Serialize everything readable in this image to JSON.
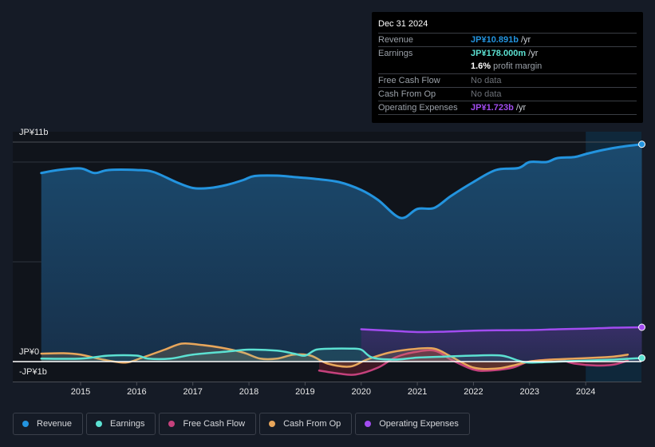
{
  "tooltip": {
    "date": "Dec 31 2024",
    "rows": [
      {
        "label": "Revenue",
        "value": "JP¥10.891b",
        "suffix": " /yr",
        "color": "#2394df"
      },
      {
        "label": "Earnings",
        "value": "JP¥178.000m",
        "suffix": " /yr",
        "color": "#5ce1d2"
      },
      {
        "label": "",
        "value": "1.6%",
        "suffix": " profit margin",
        "color": "#ffffff"
      },
      {
        "label": "Free Cash Flow",
        "value": "",
        "suffix": "No data",
        "color": "#9aa0a8"
      },
      {
        "label": "Cash From Op",
        "value": "",
        "suffix": "No data",
        "color": "#9aa0a8"
      },
      {
        "label": "Operating Expenses",
        "value": "JP¥1.723b",
        "suffix": " /yr",
        "color": "#a24cf0"
      }
    ]
  },
  "chart_data": {
    "type": "area",
    "title": "",
    "xlabel": "",
    "ylabel": "",
    "y_tick_labels": {
      "top": "JP¥11b",
      "zero": "JP¥0",
      "bottom": "-JP¥1b"
    },
    "ylim": [
      -1,
      11
    ],
    "xlim": [
      2014.3,
      2025.0
    ],
    "x_ticks": [
      "2015",
      "2016",
      "2017",
      "2018",
      "2019",
      "2020",
      "2021",
      "2022",
      "2023",
      "2024"
    ],
    "x_tick_values": [
      2015,
      2016,
      2017,
      2018,
      2019,
      2020,
      2021,
      2022,
      2023,
      2024
    ],
    "grid": true,
    "legend_position": "bottom",
    "forecast_shade_from": 2024.0,
    "units": "JP¥ billions",
    "series": [
      {
        "name": "Revenue",
        "color": "#2394df",
        "points": [
          [
            2014.3,
            9.45
          ],
          [
            2014.6,
            9.6
          ],
          [
            2015.0,
            9.68
          ],
          [
            2015.25,
            9.45
          ],
          [
            2015.5,
            9.6
          ],
          [
            2016.0,
            9.6
          ],
          [
            2016.3,
            9.5
          ],
          [
            2016.7,
            9.0
          ],
          [
            2017.0,
            8.7
          ],
          [
            2017.3,
            8.7
          ],
          [
            2017.6,
            8.85
          ],
          [
            2017.9,
            9.1
          ],
          [
            2018.1,
            9.3
          ],
          [
            2018.5,
            9.32
          ],
          [
            2018.8,
            9.25
          ],
          [
            2019.2,
            9.15
          ],
          [
            2019.6,
            9.0
          ],
          [
            2020.0,
            8.6
          ],
          [
            2020.3,
            8.1
          ],
          [
            2020.7,
            7.2
          ],
          [
            2021.0,
            7.65
          ],
          [
            2021.3,
            7.7
          ],
          [
            2021.6,
            8.3
          ],
          [
            2022.0,
            9.0
          ],
          [
            2022.4,
            9.6
          ],
          [
            2022.8,
            9.7
          ],
          [
            2023.0,
            10.0
          ],
          [
            2023.3,
            10.0
          ],
          [
            2023.5,
            10.2
          ],
          [
            2023.8,
            10.25
          ],
          [
            2024.0,
            10.4
          ],
          [
            2024.3,
            10.6
          ],
          [
            2024.6,
            10.75
          ],
          [
            2025.0,
            10.89
          ]
        ]
      },
      {
        "name": "Earnings",
        "color": "#5ce1d2",
        "points": [
          [
            2014.3,
            0.15
          ],
          [
            2015.0,
            0.15
          ],
          [
            2015.5,
            0.3
          ],
          [
            2016.0,
            0.3
          ],
          [
            2016.2,
            0.15
          ],
          [
            2016.6,
            0.15
          ],
          [
            2017.0,
            0.35
          ],
          [
            2017.6,
            0.5
          ],
          [
            2018.0,
            0.6
          ],
          [
            2018.5,
            0.55
          ],
          [
            2018.8,
            0.4
          ],
          [
            2019.0,
            0.3
          ],
          [
            2019.2,
            0.6
          ],
          [
            2019.5,
            0.65
          ],
          [
            2019.8,
            0.65
          ],
          [
            2020.0,
            0.6
          ],
          [
            2020.2,
            0.2
          ],
          [
            2020.6,
            0.1
          ],
          [
            2021.0,
            0.2
          ],
          [
            2021.5,
            0.25
          ],
          [
            2022.0,
            0.3
          ],
          [
            2022.5,
            0.3
          ],
          [
            2022.8,
            0.05
          ],
          [
            2023.0,
            -0.05
          ],
          [
            2023.5,
            0.0
          ],
          [
            2024.0,
            0.05
          ],
          [
            2024.5,
            0.1
          ],
          [
            2025.0,
            0.18
          ]
        ]
      },
      {
        "name": "Free Cash Flow",
        "color": "#c5417c",
        "points": [
          [
            2019.25,
            -0.45
          ],
          [
            2019.6,
            -0.6
          ],
          [
            2019.9,
            -0.65
          ],
          [
            2020.3,
            -0.3
          ],
          [
            2020.6,
            0.2
          ],
          [
            2020.9,
            0.45
          ],
          [
            2021.3,
            0.55
          ],
          [
            2021.6,
            0.1
          ],
          [
            2022.0,
            -0.4
          ],
          [
            2022.3,
            -0.45
          ],
          [
            2022.7,
            -0.3
          ],
          [
            2023.0,
            0.0
          ],
          [
            2023.5,
            0.1
          ],
          [
            2023.8,
            -0.1
          ],
          [
            2024.2,
            -0.2
          ],
          [
            2024.5,
            -0.15
          ],
          [
            2024.75,
            0.05
          ]
        ]
      },
      {
        "name": "Cash From Op",
        "color": "#e8a65b",
        "points": [
          [
            2014.3,
            0.4
          ],
          [
            2014.7,
            0.42
          ],
          [
            2015.0,
            0.35
          ],
          [
            2015.4,
            0.1
          ],
          [
            2015.8,
            -0.05
          ],
          [
            2016.1,
            0.2
          ],
          [
            2016.5,
            0.6
          ],
          [
            2016.8,
            0.9
          ],
          [
            2017.1,
            0.85
          ],
          [
            2017.5,
            0.7
          ],
          [
            2017.9,
            0.45
          ],
          [
            2018.2,
            0.15
          ],
          [
            2018.5,
            0.15
          ],
          [
            2018.8,
            0.35
          ],
          [
            2019.1,
            0.3
          ],
          [
            2019.4,
            -0.1
          ],
          [
            2019.8,
            -0.25
          ],
          [
            2020.1,
            0.1
          ],
          [
            2020.5,
            0.45
          ],
          [
            2020.9,
            0.62
          ],
          [
            2021.3,
            0.65
          ],
          [
            2021.6,
            0.25
          ],
          [
            2022.0,
            -0.3
          ],
          [
            2022.4,
            -0.35
          ],
          [
            2022.7,
            -0.2
          ],
          [
            2023.0,
            0.0
          ],
          [
            2023.4,
            0.1
          ],
          [
            2023.8,
            0.15
          ],
          [
            2024.2,
            0.2
          ],
          [
            2024.5,
            0.25
          ],
          [
            2024.75,
            0.35
          ]
        ]
      },
      {
        "name": "Operating Expenses",
        "color": "#a24cf0",
        "points": [
          [
            2020.0,
            1.62
          ],
          [
            2020.5,
            1.55
          ],
          [
            2021.0,
            1.48
          ],
          [
            2021.5,
            1.5
          ],
          [
            2022.0,
            1.55
          ],
          [
            2022.5,
            1.57
          ],
          [
            2023.0,
            1.58
          ],
          [
            2023.5,
            1.62
          ],
          [
            2024.0,
            1.65
          ],
          [
            2024.5,
            1.7
          ],
          [
            2025.0,
            1.72
          ]
        ]
      }
    ]
  },
  "legend": [
    {
      "label": "Revenue",
      "color": "#2394df"
    },
    {
      "label": "Earnings",
      "color": "#5ce1d2"
    },
    {
      "label": "Free Cash Flow",
      "color": "#c5417c"
    },
    {
      "label": "Cash From Op",
      "color": "#e8a65b"
    },
    {
      "label": "Operating Expenses",
      "color": "#a24cf0"
    }
  ]
}
